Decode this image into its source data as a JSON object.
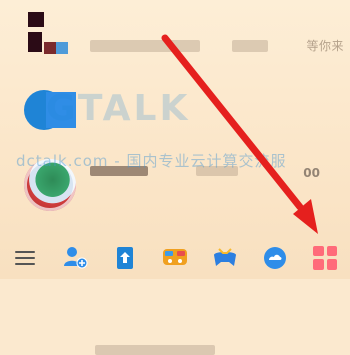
{
  "contacts": [
    {
      "right_text": "等你来"
    },
    {
      "right_text": "00"
    },
    {
      "right_text": ""
    }
  ],
  "watermark": {
    "logo": "GTALK",
    "text": "dctalk.com - 国内专业云计算交流服"
  },
  "bottom_bar": {
    "items": [
      {
        "name": "menu-icon"
      },
      {
        "name": "add-contact-icon"
      },
      {
        "name": "upload-icon"
      },
      {
        "name": "game-center-icon"
      },
      {
        "name": "games-icon"
      },
      {
        "name": "cloud-icon"
      },
      {
        "name": "apps-grid-icon"
      }
    ]
  },
  "colors": {
    "accent_blue": "#1f84d6",
    "arrow_red": "#e5201e",
    "tile_pink": "#ff6b7a"
  }
}
